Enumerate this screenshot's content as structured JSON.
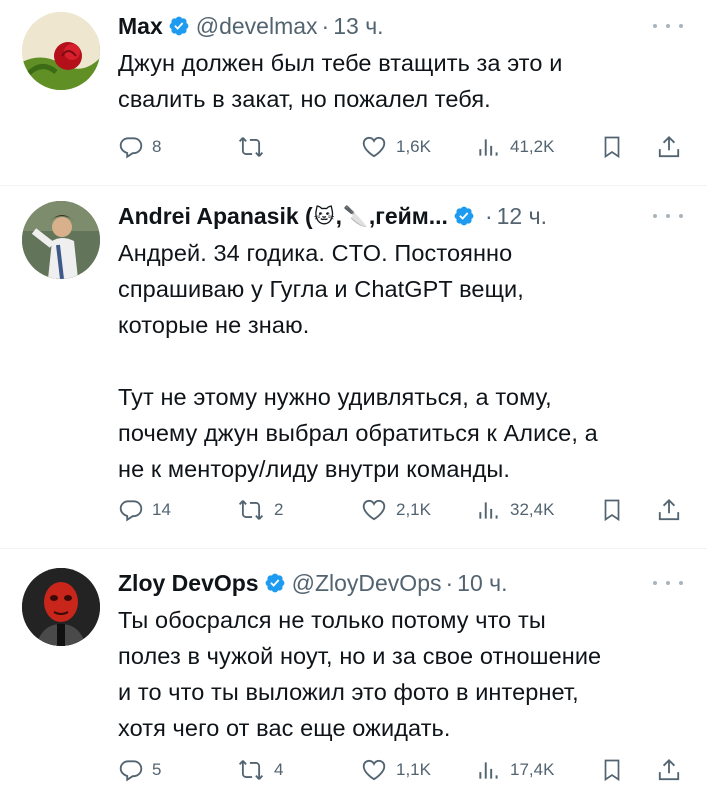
{
  "tweets": [
    {
      "name": "Max",
      "handle": "@develmax",
      "dot": "·",
      "time": "13 ч.",
      "text": "Джун должен был тебе втащить за это и\nсвалить в закат, но пожалел тебя.",
      "replies": "8",
      "retweets": "",
      "likes": "1,6K",
      "views": "41,2K"
    },
    {
      "name": "Andrei Apanasik (",
      "name_suffix": ",гейм...",
      "name_emoji_1": "🐱",
      "name_sep": ",",
      "name_emoji_2": "🔪",
      "handle": "",
      "dot": "·",
      "time": "12 ч.",
      "text": "Андрей. 34 годика. CTO. Постоянно\nспрашиваю у Гугла и ChatGPT вещи,\nкоторые не знаю.\n\nТут не этому нужно удивляться, а тому,\nпочему джун выбрал обратиться к Алисе, а\nне к ментору/лиду внутри команды.",
      "replies": "14",
      "retweets": "2",
      "likes": "2,1K",
      "views": "32,4K"
    },
    {
      "name": "Zloy DevOps",
      "handle": "@ZloyDevOps",
      "dot": "·",
      "time": "10 ч.",
      "text": "Ты обосрался не только потому что ты\nполез в чужой ноут, но и за свое отношение\nи то что ты выложил это фото в интернет,\nхотя чего от вас еще ожидать.",
      "replies": "5",
      "retweets": "4",
      "likes": "1,1K",
      "views": "17,4K"
    }
  ],
  "colors": {
    "verified": "#1d9bf0",
    "muted": "#536471",
    "text": "#0f1419",
    "divider": "#eff3f4"
  },
  "icons": [
    "verified-badge-icon",
    "more-icon",
    "reply-icon",
    "retweet-icon",
    "like-icon",
    "views-icon",
    "bookmark-icon",
    "share-icon"
  ]
}
